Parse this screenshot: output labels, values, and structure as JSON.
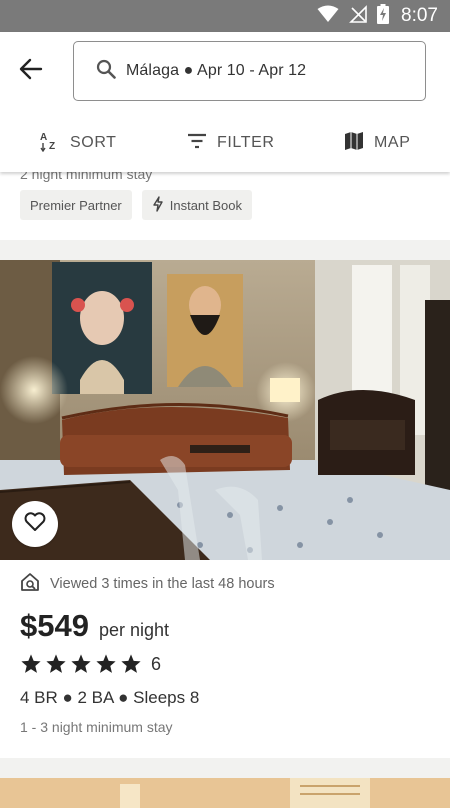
{
  "status_bar": {
    "time": "8:07"
  },
  "search": {
    "query": "Málaga ● Apr 10 - Apr 12"
  },
  "toolbar": {
    "sort_label": "SORT",
    "filter_label": "FILTER",
    "map_label": "MAP"
  },
  "previous_listing": {
    "cutoff_text": "2 night minimum stay",
    "badges": [
      "Premier Partner",
      "Instant Book"
    ]
  },
  "listing": {
    "viewed_text": "Viewed 3 times in the last 48 hours",
    "price": "$549",
    "price_unit": "per night",
    "rating_stars": 5,
    "review_count": "6",
    "details": "4 BR ● 2 BA ● Sleeps 8",
    "min_stay": "1 - 3 night minimum stay"
  },
  "colors": {
    "status_bar": "#7a7a7a",
    "background": "#f2f2f0",
    "text_primary": "#222222"
  }
}
